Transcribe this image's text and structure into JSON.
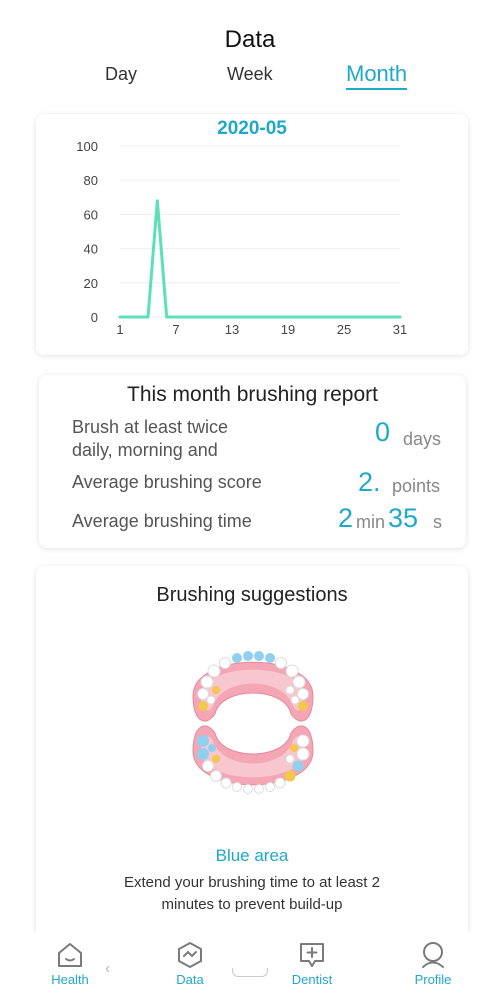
{
  "page": {
    "title": "Data"
  },
  "colors": {
    "accent": "#1fa9c9",
    "series": "#5ce0b8",
    "text_gray": "#555555"
  },
  "tabs": [
    {
      "label": "Day",
      "active": false
    },
    {
      "label": "Week",
      "active": false
    },
    {
      "label": "Month",
      "active": true
    }
  ],
  "chart_data": {
    "type": "line",
    "title": "2020-05",
    "x": [
      1,
      2,
      3,
      4,
      5,
      6,
      7,
      8,
      9,
      10,
      11,
      12,
      13,
      14,
      15,
      16,
      17,
      18,
      19,
      20,
      21,
      22,
      23,
      24,
      25,
      26,
      27,
      28,
      29,
      30,
      31
    ],
    "series": [
      {
        "values": [
          0,
          0,
          0,
          0,
          68,
          0,
          0,
          0,
          0,
          0,
          0,
          0,
          0,
          0,
          0,
          0,
          0,
          0,
          0,
          0,
          0,
          0,
          0,
          0,
          0,
          0,
          0,
          0,
          0,
          0,
          0
        ]
      }
    ],
    "x_ticks": [
      1,
      7,
      13,
      19,
      25,
      31
    ],
    "y_ticks": [
      0,
      20,
      40,
      60,
      80,
      100
    ],
    "xlim": [
      1,
      31
    ],
    "ylim": [
      0,
      100
    ],
    "grid": true
  },
  "report": {
    "title": "This month brushing report",
    "rows": [
      {
        "label_line1": "Brush at least twice",
        "label_line2": "daily, morning and",
        "value": "0",
        "unit": "days"
      },
      {
        "label": "Average brushing score",
        "value": "2.",
        "unit": "points"
      },
      {
        "label": "Average brushing time",
        "minutes": "2",
        "min_unit": "min",
        "seconds": "35",
        "sec_unit": "s"
      }
    ]
  },
  "suggestions": {
    "title": "Brushing suggestions",
    "area_label": "Blue area",
    "description": "Extend your brushing time to at least 2 minutes to prevent build-up"
  },
  "nav": [
    {
      "label": "Health",
      "icon": "home-icon",
      "active": true
    },
    {
      "label": "Data",
      "icon": "data-icon",
      "active": false
    },
    {
      "label": "Dentist",
      "icon": "dentist-chat-icon",
      "active": false
    },
    {
      "label": "Profile",
      "icon": "profile-icon",
      "active": false
    }
  ]
}
